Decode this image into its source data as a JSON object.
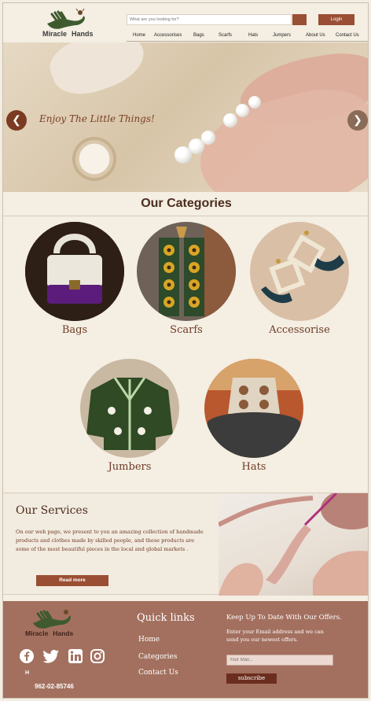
{
  "header": {
    "brand_part1": "Miracle",
    "brand_part2": "Hands",
    "search_placeholder": "What are you looking for?",
    "login_label": "Login",
    "nav": [
      "Home",
      "Accessorises",
      "Bags",
      "Scarfs",
      "Hats",
      "Jumpers",
      "About Us",
      "Contact Us"
    ]
  },
  "hero": {
    "tagline": "Enjoy The Little Things!",
    "prev_icon": "chevron-left-icon",
    "next_icon": "chevron-right-icon"
  },
  "categories": {
    "title": "Our Categories",
    "items": [
      {
        "label": "Bags"
      },
      {
        "label": "Scarfs"
      },
      {
        "label": "Accessorise"
      },
      {
        "label": "Jumbers"
      },
      {
        "label": "Hats"
      }
    ]
  },
  "services": {
    "title": "Our Services",
    "text": "On our web page, we present to you an amazing collection of handmade products and clothes made by skilled people, and these products are some of the most beautiful pieces in the local and global markets .",
    "button_label": "Read more"
  },
  "footer": {
    "brand_part1": "Miracle",
    "brand_part2": "Hands",
    "social_icons": [
      "facebook-icon",
      "twitter-icon",
      "linkedin-icon",
      "instagram-icon"
    ],
    "small_text": "H",
    "phone": "962-02-85746",
    "quick_links_title": "Quick links",
    "quick_links": [
      "Home",
      "Categories",
      "Contact Us"
    ],
    "offers_title": "Keep Up To Date With Our Offers.",
    "offers_text": "Enter your Email address and we can send you our newest offers.",
    "email_placeholder": "Your Mail...",
    "subscribe_label": "subscribe"
  },
  "colors": {
    "accent": "#9a4e33",
    "footer_bg": "#a3705f",
    "page_bg": "#f4eee3",
    "heading": "#4b2c1c"
  }
}
